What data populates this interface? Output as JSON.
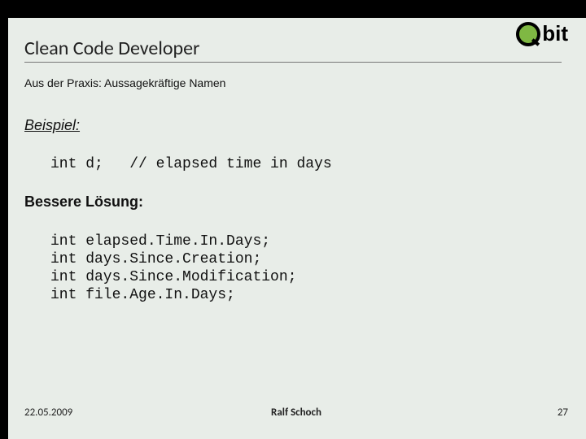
{
  "logo": {
    "text": "bit"
  },
  "title": "Clean Code Developer",
  "subtitle": "Aus der Praxis: Aussagekräftige Namen",
  "example_heading": "Beispiel:",
  "code_example": "int d;   // elapsed time in days",
  "better_heading": "Bessere Lösung:",
  "code_better": "int elapsed.Time.In.Days;\nint days.Since.Creation;\nint days.Since.Modification;\nint file.Age.In.Days;",
  "footer": {
    "date": "22.05.2009",
    "author": "Ralf Schoch",
    "page": "27"
  }
}
